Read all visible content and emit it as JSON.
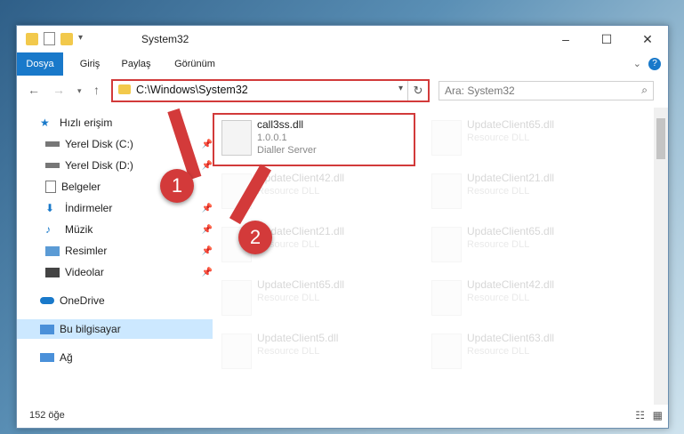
{
  "window": {
    "title": "System32"
  },
  "ribbon": {
    "tabs": [
      "Dosya",
      "Giriş",
      "Paylaş",
      "Görünüm"
    ]
  },
  "address": {
    "path": "C:\\Windows\\System32"
  },
  "search": {
    "placeholder": "Ara: System32"
  },
  "sidebar": {
    "items": [
      {
        "label": "Hızlı erişim",
        "icon": "star-icon"
      },
      {
        "label": "Yerel Disk (C:)",
        "icon": "drive-icon"
      },
      {
        "label": "Yerel Disk (D:)",
        "icon": "drive-icon"
      },
      {
        "label": "Belgeler",
        "icon": "document-icon"
      },
      {
        "label": "İndirmeler",
        "icon": "download-icon"
      },
      {
        "label": "Müzik",
        "icon": "music-icon"
      },
      {
        "label": "Resimler",
        "icon": "image-icon"
      },
      {
        "label": "Videolar",
        "icon": "video-icon"
      },
      {
        "label": "OneDrive",
        "icon": "cloud-icon"
      },
      {
        "label": "Bu bilgisayar",
        "icon": "computer-icon"
      },
      {
        "label": "Ağ",
        "icon": "network-icon"
      }
    ]
  },
  "files": {
    "main": {
      "name": "call3ss.dll",
      "version": "1.0.0.1",
      "desc": "Dialler Server"
    },
    "col1": [
      {
        "name": "UpdateClient42.dll",
        "desc": "Resource DLL"
      },
      {
        "name": "UpdateClient21.dll",
        "desc": "Resource DLL"
      },
      {
        "name": "UpdateClient65.dll",
        "desc": "Resource DLL"
      },
      {
        "name": "UpdateClient5.dll",
        "desc": "Resource DLL"
      }
    ],
    "col2": [
      {
        "name": "UpdateClient65.dll",
        "desc": "Resource DLL"
      },
      {
        "name": "UpdateClient21.dll",
        "desc": "Resource DLL"
      },
      {
        "name": "UpdateClient65.dll",
        "desc": "Resource DLL"
      },
      {
        "name": "UpdateClient42.dll",
        "desc": "Resource DLL"
      },
      {
        "name": "UpdateClient63.dll",
        "desc": "Resource DLL"
      }
    ]
  },
  "status": {
    "count": "152 öğe"
  },
  "annotations": {
    "badge1": "1",
    "badge2": "2"
  },
  "colors": {
    "accent": "#1979ca",
    "highlight": "#d23a3a"
  }
}
